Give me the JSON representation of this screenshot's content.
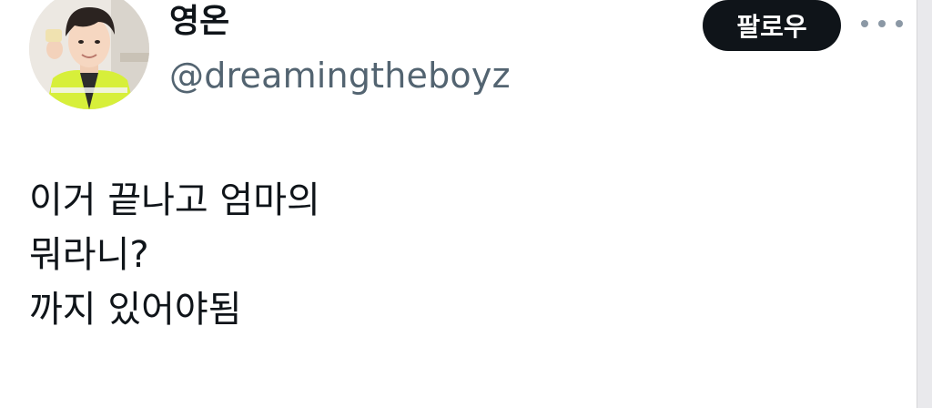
{
  "profile": {
    "display_name": "영온",
    "handle": "@dreamingtheboyz",
    "avatar_icon": "profile-photo"
  },
  "actions": {
    "follow_label": "팔로우",
    "more_icon": "more-options-icon"
  },
  "tweet": {
    "lines": [
      "이거 끝나고 엄마의",
      "뭐라니?",
      "까지 있어야됨"
    ]
  },
  "colors": {
    "text_primary": "#0f1419",
    "text_secondary": "#536471",
    "button_bg": "#0f1419",
    "button_text": "#ffffff"
  }
}
